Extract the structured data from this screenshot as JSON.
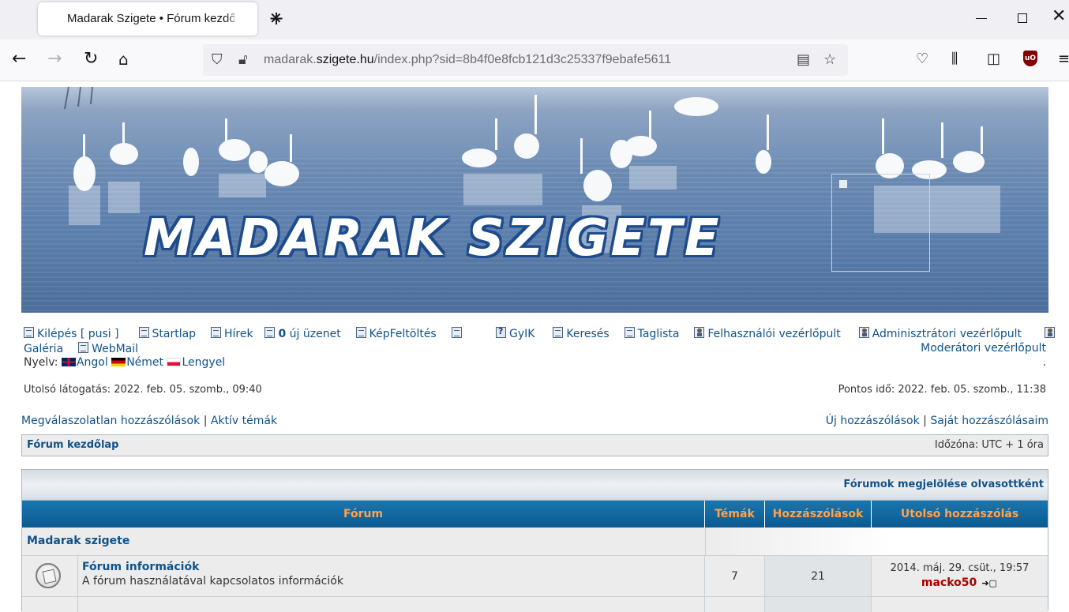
{
  "browser": {
    "tab_title": "Madarak Szigete • Fórum kezdőlap",
    "tab_close": "✕",
    "new_tab": "+",
    "url_prefix": "madarak.",
    "url_domain": "szigete.hu",
    "url_path": "/index.php?sid=8b4f0e8fcb121d3c25337f9ebafe5611",
    "icons": [
      "back-icon",
      "forward-icon",
      "reload-icon",
      "home-icon",
      "shield-icon",
      "lock-slash-icon",
      "reader-icon",
      "bookmark-star-icon",
      "pocket-icon",
      "library-icon",
      "sidebar-icon",
      "ublock-icon",
      "menu-icon"
    ]
  },
  "banner": {
    "title": "MADARAK SZIGETE",
    "broken_image_glyph": "▣"
  },
  "nav": {
    "logout": "Kilépés [ pusi ]",
    "home": "Startlap",
    "news": "Hírek",
    "new_msg_count": "0",
    "new_msg_label": "új üzenet",
    "upload": "KépFeltöltés",
    "faq": "GyIK",
    "search": "Keresés",
    "members": "Taglista",
    "ucp": "Felhasználói vezérlőpult",
    "acp": "Adminisztrátori vezérlőpult",
    "gallery": "Galéria",
    "webmail": "WebMail",
    "mcp": "Moderátori vezérlőpult",
    "dot": ".",
    "language_label": "Nyelv:",
    "lang_en": "Angol",
    "lang_de": "Német",
    "lang_pl": "Lengyel"
  },
  "info": {
    "last_visit": "Utolsó látogatás: 2022. feb. 05. szomb., 09:40",
    "current_time": "Pontos idő: 2022. feb. 05. szomb., 11:38"
  },
  "quick_links": {
    "unanswered": "Megválaszolatlan hozzászólások",
    "active": "Aktív témák",
    "sep": "|",
    "new_posts": "Új hozzászólások",
    "own_posts": "Saját hozzászólásaim"
  },
  "breadcrumb": {
    "home": "Fórum kezdőlap",
    "timezone": "Időzóna: UTC + 1 óra"
  },
  "forum_table": {
    "mark_read": "Fórumok megjelölése olvasottként",
    "headers": {
      "forum": "Fórum",
      "topics": "Témák",
      "posts": "Hozzászólások",
      "last_post": "Utolsó hozzászólás"
    },
    "category": "Madarak szigete",
    "rows": [
      {
        "title": "Fórum információk",
        "description": "A fórum használatával kapcsolatos információk",
        "topics": "7",
        "posts": "21",
        "last_date": "2014. máj. 29. csüt., 19:57",
        "last_user": "macko50",
        "goto": "➔▢"
      }
    ]
  }
}
